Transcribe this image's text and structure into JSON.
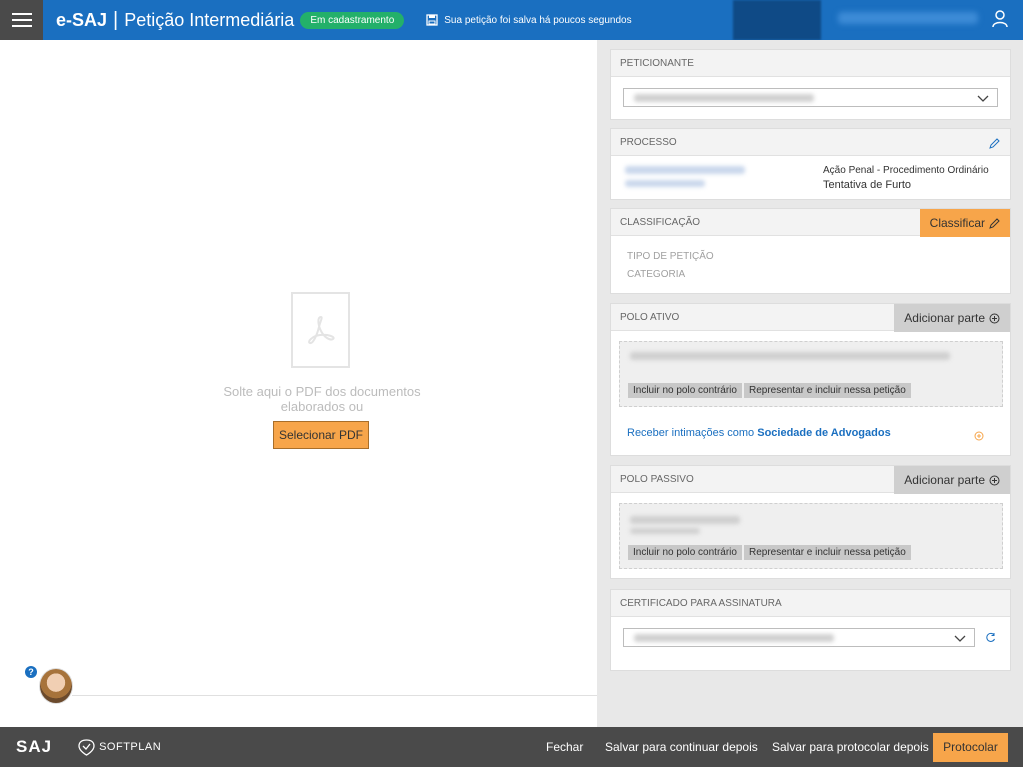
{
  "header": {
    "brand": "e-SAJ",
    "separator": "|",
    "title": "Petição Intermediária",
    "status_badge": "Em cadastramento",
    "saved_msg": "Sua petição foi salva há poucos segundos"
  },
  "drop": {
    "text": "Solte aqui o PDF dos documentos elaborados ou",
    "button": "Selecionar PDF",
    "help": "?"
  },
  "sections": {
    "peticionante": {
      "title": "PETICIONANTE"
    },
    "processo": {
      "title": "PROCESSO",
      "classe": "Ação Penal - Procedimento Ordinário",
      "assunto": "Tentativa de Furto"
    },
    "classificacao": {
      "title": "CLASSIFICAÇÃO",
      "action": "Classificar",
      "tipo_label": "TIPO DE PETIÇÃO",
      "categoria_label": "CATEGORIA"
    },
    "polo_ativo": {
      "title": "POLO ATIVO",
      "action": "Adicionar parte",
      "chip1": "Incluir no polo contrário",
      "chip2": "Representar e incluir nessa petição",
      "link_prefix": "Receber intimações como ",
      "link_strong": "Sociedade de Advogados"
    },
    "polo_passivo": {
      "title": "POLO PASSIVO",
      "action": "Adicionar parte",
      "chip1": "Incluir no polo contrário",
      "chip2": "Representar e incluir nessa petição"
    },
    "certificado": {
      "title": "CERTIFICADO PARA ASSINATURA"
    }
  },
  "footer": {
    "logo": "SAJ",
    "company": "SOFTPLAN",
    "fechar": "Fechar",
    "salvar_continuar": "Salvar para continuar depois",
    "salvar_protocolar": "Salvar para protocolar depois",
    "protocolar": "Protocolar"
  },
  "colors": {
    "header_blue": "#1a6fc0",
    "accent_orange": "#f7a54a",
    "badge_green": "#23b06a",
    "footer_dark": "#4a4a4a"
  }
}
